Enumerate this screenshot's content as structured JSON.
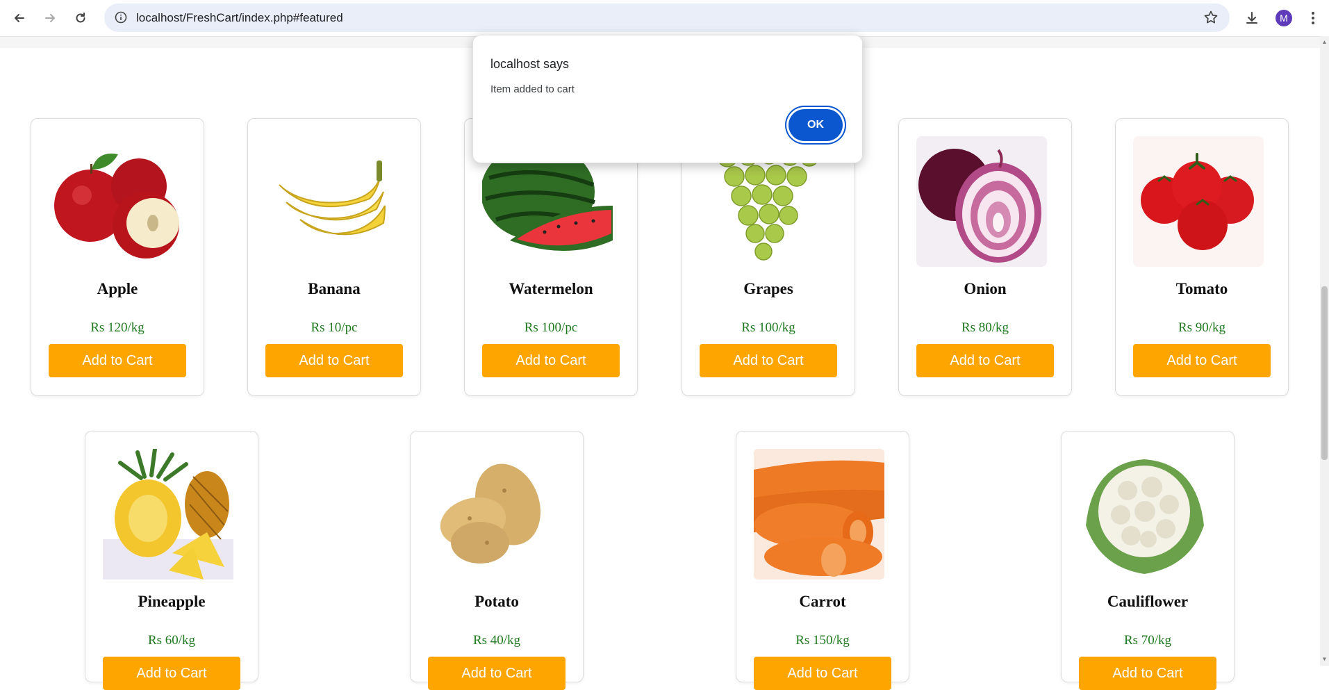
{
  "browser": {
    "url": "localhost/FreshCart/index.php#featured",
    "profile_initial": "M"
  },
  "dialog": {
    "title": "localhost says",
    "message": "Item added to cart",
    "ok_label": "OK"
  },
  "products": [
    {
      "name": "Apple",
      "price": "Rs 120/kg",
      "button": "Add to Cart"
    },
    {
      "name": "Banana",
      "price": "Rs 10/pc",
      "button": "Add to Cart"
    },
    {
      "name": "Watermelon",
      "price": "Rs 100/pc",
      "button": "Add to Cart"
    },
    {
      "name": "Grapes",
      "price": "Rs 100/kg",
      "button": "Add to Cart"
    },
    {
      "name": "Onion",
      "price": "Rs 80/kg",
      "button": "Add to Cart"
    },
    {
      "name": "Tomato",
      "price": "Rs 90/kg",
      "button": "Add to Cart"
    },
    {
      "name": "Pineapple",
      "price": "Rs 60/kg",
      "button": "Add to Cart"
    },
    {
      "name": "Potato",
      "price": "Rs 40/kg",
      "button": "Add to Cart"
    },
    {
      "name": "Carrot",
      "price": "Rs 150/kg",
      "button": "Add to Cart"
    },
    {
      "name": "Cauliflower",
      "price": "Rs 70/kg",
      "button": "Add to Cart"
    }
  ],
  "colors": {
    "button": "#ffa500",
    "price": "#1f7a1f",
    "dialog_button": "#0b57d0"
  }
}
